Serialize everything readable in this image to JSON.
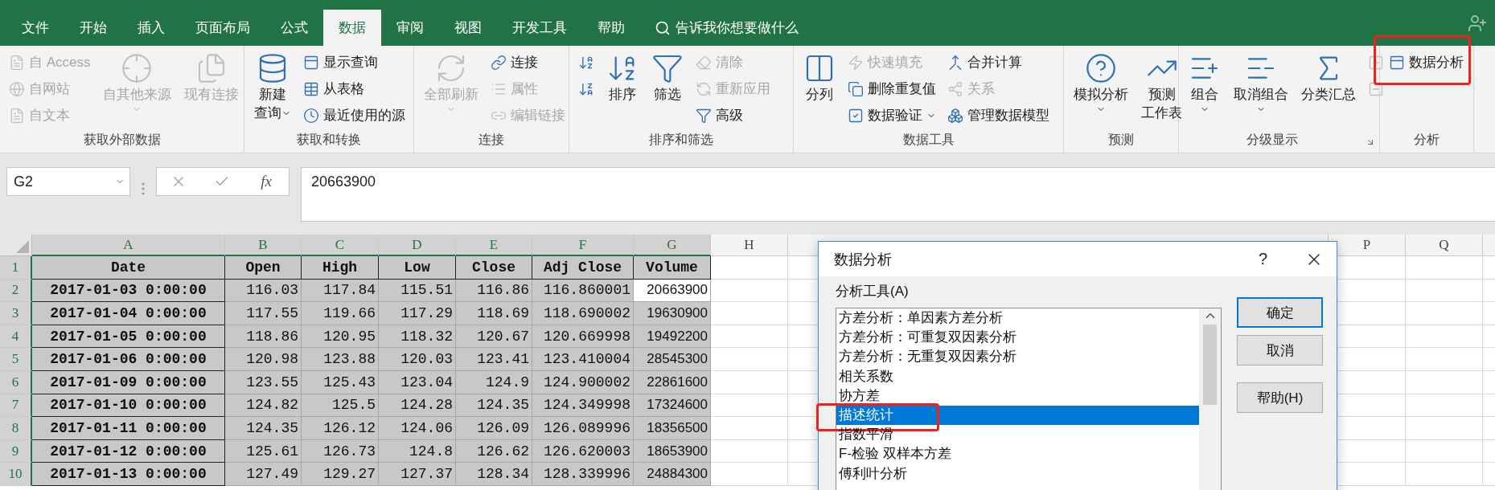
{
  "tabs": [
    {
      "label": "文件",
      "selected": false
    },
    {
      "label": "开始",
      "selected": false
    },
    {
      "label": "插入",
      "selected": false
    },
    {
      "label": "页面布局",
      "selected": false
    },
    {
      "label": "公式",
      "selected": false
    },
    {
      "label": "数据",
      "selected": true
    },
    {
      "label": "审阅",
      "selected": false
    },
    {
      "label": "视图",
      "selected": false
    },
    {
      "label": "开发工具",
      "selected": false
    },
    {
      "label": "帮助",
      "selected": false
    }
  ],
  "search": {
    "placeholder": "告诉我你想要做什么"
  },
  "ribbon": {
    "groups": [
      {
        "label": "获取外部数据",
        "launcher": false,
        "items": [
          {
            "kind": "small",
            "label": "自 Access",
            "disabled": true
          },
          {
            "kind": "small",
            "label": "自网站",
            "disabled": true
          },
          {
            "kind": "small",
            "label": "自文本",
            "disabled": true
          },
          {
            "kind": "large",
            "lines": [
              "自其他来源"
            ],
            "disabled": true,
            "dropdown": true
          },
          {
            "kind": "large",
            "lines": [
              "现有连接"
            ],
            "disabled": true,
            "dropdown": false
          }
        ]
      },
      {
        "label": "获取和转换",
        "launcher": false,
        "items": [
          {
            "kind": "large",
            "lines": [
              "新建",
              "查询"
            ],
            "disabled": false,
            "dropdown": true
          },
          {
            "kind": "small",
            "label": "显示查询",
            "disabled": false
          },
          {
            "kind": "small",
            "label": "从表格",
            "disabled": false
          },
          {
            "kind": "small",
            "label": "最近使用的源",
            "disabled": false
          }
        ]
      },
      {
        "label": "连接",
        "launcher": false,
        "items": [
          {
            "kind": "large",
            "lines": [
              "全部刷新"
            ],
            "disabled": true,
            "dropdown": true
          },
          {
            "kind": "small",
            "label": "连接",
            "disabled": false
          },
          {
            "kind": "small",
            "label": "属性",
            "disabled": true
          },
          {
            "kind": "small",
            "label": "编辑链接",
            "disabled": true
          }
        ]
      },
      {
        "label": "排序和筛选",
        "launcher": false,
        "items": [
          {
            "kind": "icon",
            "disabled": false
          },
          {
            "kind": "icon",
            "disabled": false
          },
          {
            "kind": "large",
            "lines": [
              "排序"
            ],
            "disabled": false,
            "dropdown": false
          },
          {
            "kind": "large",
            "lines": [
              "筛选"
            ],
            "disabled": false,
            "dropdown": false
          },
          {
            "kind": "small",
            "label": "清除",
            "disabled": true
          },
          {
            "kind": "small",
            "label": "重新应用",
            "disabled": true
          },
          {
            "kind": "small",
            "label": "高级",
            "disabled": false
          }
        ]
      },
      {
        "label": "数据工具",
        "launcher": false,
        "items": [
          {
            "kind": "large",
            "lines": [
              "分列"
            ],
            "disabled": false,
            "dropdown": false
          },
          {
            "kind": "small",
            "label": "快速填充",
            "disabled": true
          },
          {
            "kind": "small",
            "label": "删除重复值",
            "disabled": false
          },
          {
            "kind": "small",
            "label": "数据验证",
            "disabled": false,
            "dropdown": true
          },
          {
            "kind": "small",
            "label": "合并计算",
            "disabled": false
          },
          {
            "kind": "small",
            "label": "关系",
            "disabled": true
          },
          {
            "kind": "small",
            "label": "管理数据模型",
            "disabled": false
          }
        ]
      },
      {
        "label": "预测",
        "launcher": false,
        "items": [
          {
            "kind": "large",
            "lines": [
              "模拟分析"
            ],
            "disabled": false,
            "dropdown": true
          },
          {
            "kind": "large",
            "lines": [
              "预测",
              "工作表"
            ],
            "disabled": false,
            "dropdown": false
          }
        ]
      },
      {
        "label": "分级显示",
        "launcher": true,
        "items": [
          {
            "kind": "large",
            "lines": [
              "组合"
            ],
            "disabled": false,
            "dropdown": true
          },
          {
            "kind": "large",
            "lines": [
              "取消组合"
            ],
            "disabled": false,
            "dropdown": true
          },
          {
            "kind": "large",
            "lines": [
              "分类汇总"
            ],
            "disabled": false,
            "dropdown": false
          },
          {
            "kind": "icon",
            "disabled": true
          },
          {
            "kind": "icon",
            "disabled": true
          }
        ]
      },
      {
        "label": "分析",
        "launcher": false,
        "items": [
          {
            "kind": "small",
            "label": "数据分析",
            "disabled": false,
            "highlighted": true
          }
        ]
      }
    ]
  },
  "formula_bar": {
    "name_box": "G2",
    "function_button": "fx",
    "value": "20663900"
  },
  "table": {
    "columns": [
      {
        "label": "A",
        "selected": true
      },
      {
        "label": "B",
        "selected": true
      },
      {
        "label": "C",
        "selected": true
      },
      {
        "label": "D",
        "selected": true
      },
      {
        "label": "E",
        "selected": true
      },
      {
        "label": "F",
        "selected": true
      },
      {
        "label": "G",
        "selected": true
      },
      {
        "label": "H",
        "selected": false
      },
      {
        "label": "P",
        "selected": false
      },
      {
        "label": "Q",
        "selected": false
      }
    ],
    "rows": [
      {
        "number": "1",
        "kind": "header",
        "selected": true,
        "cells": [
          {
            "text": "Date",
            "active": false
          },
          {
            "text": "Open",
            "active": false
          },
          {
            "text": "High",
            "active": false
          },
          {
            "text": "Low",
            "active": false
          },
          {
            "text": "Close",
            "active": false
          },
          {
            "text": "Adj Close",
            "active": false
          },
          {
            "text": "Volume",
            "active": false
          }
        ]
      },
      {
        "number": "2",
        "kind": "data",
        "selected": true,
        "cells": [
          {
            "text": "2017-01-03 0:00:00",
            "active": false
          },
          {
            "text": "116.03",
            "active": false
          },
          {
            "text": "117.84",
            "active": false
          },
          {
            "text": "115.51",
            "active": false
          },
          {
            "text": "116.86",
            "active": false
          },
          {
            "text": "116.860001",
            "active": false
          },
          {
            "text": "20663900",
            "active": true
          }
        ]
      },
      {
        "number": "3",
        "kind": "data",
        "selected": true,
        "cells": [
          {
            "text": "2017-01-04 0:00:00",
            "active": false
          },
          {
            "text": "117.55",
            "active": false
          },
          {
            "text": "119.66",
            "active": false
          },
          {
            "text": "117.29",
            "active": false
          },
          {
            "text": "118.69",
            "active": false
          },
          {
            "text": "118.690002",
            "active": false
          },
          {
            "text": "19630900",
            "active": false
          }
        ]
      },
      {
        "number": "4",
        "kind": "data",
        "selected": true,
        "cells": [
          {
            "text": "2017-01-05 0:00:00",
            "active": false
          },
          {
            "text": "118.86",
            "active": false
          },
          {
            "text": "120.95",
            "active": false
          },
          {
            "text": "118.32",
            "active": false
          },
          {
            "text": "120.67",
            "active": false
          },
          {
            "text": "120.669998",
            "active": false
          },
          {
            "text": "19492200",
            "active": false
          }
        ]
      },
      {
        "number": "5",
        "kind": "data",
        "selected": true,
        "cells": [
          {
            "text": "2017-01-06 0:00:00",
            "active": false
          },
          {
            "text": "120.98",
            "active": false
          },
          {
            "text": "123.88",
            "active": false
          },
          {
            "text": "120.03",
            "active": false
          },
          {
            "text": "123.41",
            "active": false
          },
          {
            "text": "123.410004",
            "active": false
          },
          {
            "text": "28545300",
            "active": false
          }
        ]
      },
      {
        "number": "6",
        "kind": "data",
        "selected": true,
        "cells": [
          {
            "text": "2017-01-09 0:00:00",
            "active": false
          },
          {
            "text": "123.55",
            "active": false
          },
          {
            "text": "125.43",
            "active": false
          },
          {
            "text": "123.04",
            "active": false
          },
          {
            "text": "124.9",
            "active": false
          },
          {
            "text": "124.900002",
            "active": false
          },
          {
            "text": "22861600",
            "active": false
          }
        ]
      },
      {
        "number": "7",
        "kind": "data",
        "selected": true,
        "cells": [
          {
            "text": "2017-01-10 0:00:00",
            "active": false
          },
          {
            "text": "124.82",
            "active": false
          },
          {
            "text": "125.5",
            "active": false
          },
          {
            "text": "124.28",
            "active": false
          },
          {
            "text": "124.35",
            "active": false
          },
          {
            "text": "124.349998",
            "active": false
          },
          {
            "text": "17324600",
            "active": false
          }
        ]
      },
      {
        "number": "8",
        "kind": "data",
        "selected": true,
        "cells": [
          {
            "text": "2017-01-11 0:00:00",
            "active": false
          },
          {
            "text": "124.35",
            "active": false
          },
          {
            "text": "126.12",
            "active": false
          },
          {
            "text": "124.06",
            "active": false
          },
          {
            "text": "126.09",
            "active": false
          },
          {
            "text": "126.089996",
            "active": false
          },
          {
            "text": "18356500",
            "active": false
          }
        ]
      },
      {
        "number": "9",
        "kind": "data",
        "selected": true,
        "cells": [
          {
            "text": "2017-01-12 0:00:00",
            "active": false
          },
          {
            "text": "125.61",
            "active": false
          },
          {
            "text": "126.73",
            "active": false
          },
          {
            "text": "124.8",
            "active": false
          },
          {
            "text": "126.62",
            "active": false
          },
          {
            "text": "126.620003",
            "active": false
          },
          {
            "text": "18653900",
            "active": false
          }
        ]
      },
      {
        "number": "10",
        "kind": "data",
        "selected": true,
        "cells": [
          {
            "text": "2017-01-13 0:00:00",
            "active": false
          },
          {
            "text": "127.49",
            "active": false
          },
          {
            "text": "129.27",
            "active": false
          },
          {
            "text": "127.37",
            "active": false
          },
          {
            "text": "128.34",
            "active": false
          },
          {
            "text": "128.339996",
            "active": false
          },
          {
            "text": "24884300",
            "active": false
          }
        ]
      }
    ]
  },
  "dialog": {
    "title": "数据分析",
    "help_glyph": "?",
    "list_label": "分析工具(A)",
    "tools": [
      {
        "label": "方差分析：单因素方差分析",
        "selected": false,
        "highlighted": false
      },
      {
        "label": "方差分析：可重复双因素分析",
        "selected": false,
        "highlighted": false
      },
      {
        "label": "方差分析：无重复双因素分析",
        "selected": false,
        "highlighted": false
      },
      {
        "label": "相关系数",
        "selected": false,
        "highlighted": false
      },
      {
        "label": "协方差",
        "selected": false,
        "highlighted": false
      },
      {
        "label": "描述统计",
        "selected": true,
        "highlighted": true
      },
      {
        "label": "指数平滑",
        "selected": false,
        "highlighted": false
      },
      {
        "label": "F-检验 双样本方差",
        "selected": false,
        "highlighted": false
      },
      {
        "label": "傅利叶分析",
        "selected": false,
        "highlighted": false
      }
    ],
    "buttons": [
      {
        "label": "确定",
        "default": true
      },
      {
        "label": "取消",
        "default": false
      },
      {
        "label": "帮助(H)",
        "default": false
      }
    ]
  }
}
